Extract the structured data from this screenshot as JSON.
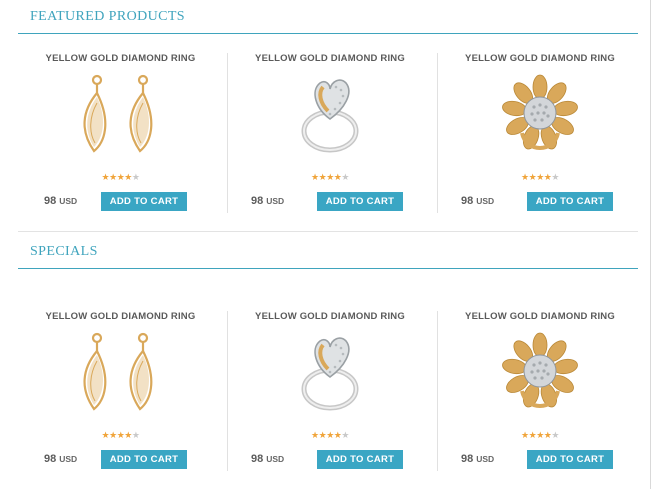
{
  "sections": [
    {
      "title": "FEATURED PRODUCTS",
      "products": [
        {
          "name": "YELLOW GOLD DIAMOND RING",
          "price": "98",
          "currency": "USD",
          "rating": 4,
          "rating_max": 5,
          "button": "ADD TO CART",
          "image_icon": "earrings-icon"
        },
        {
          "name": "YELLOW GOLD DIAMOND RING",
          "price": "98",
          "currency": "USD",
          "rating": 4,
          "rating_max": 5,
          "button": "ADD TO CART",
          "image_icon": "heart-ring-icon"
        },
        {
          "name": "YELLOW GOLD DIAMOND RING",
          "price": "98",
          "currency": "USD",
          "rating": 4,
          "rating_max": 5,
          "button": "ADD TO CART",
          "image_icon": "flower-ring-icon"
        }
      ]
    },
    {
      "title": "SPECIALS",
      "products": [
        {
          "name": "YELLOW GOLD DIAMOND RING",
          "price": "98",
          "currency": "USD",
          "rating": 4,
          "rating_max": 5,
          "button": "ADD TO CART",
          "image_icon": "earrings-icon"
        },
        {
          "name": "YELLOW GOLD DIAMOND RING",
          "price": "98",
          "currency": "USD",
          "rating": 4,
          "rating_max": 5,
          "button": "ADD TO CART",
          "image_icon": "heart-ring-icon"
        },
        {
          "name": "YELLOW GOLD DIAMOND RING",
          "price": "98",
          "currency": "USD",
          "rating": 4,
          "rating_max": 5,
          "button": "ADD TO CART",
          "image_icon": "flower-ring-icon"
        }
      ]
    }
  ],
  "colors": {
    "accent": "#3fa4bd",
    "button": "#3aa6c4",
    "star_on": "#f0a43a",
    "star_off": "#c9c9c9",
    "gold": "#d9a85a"
  }
}
